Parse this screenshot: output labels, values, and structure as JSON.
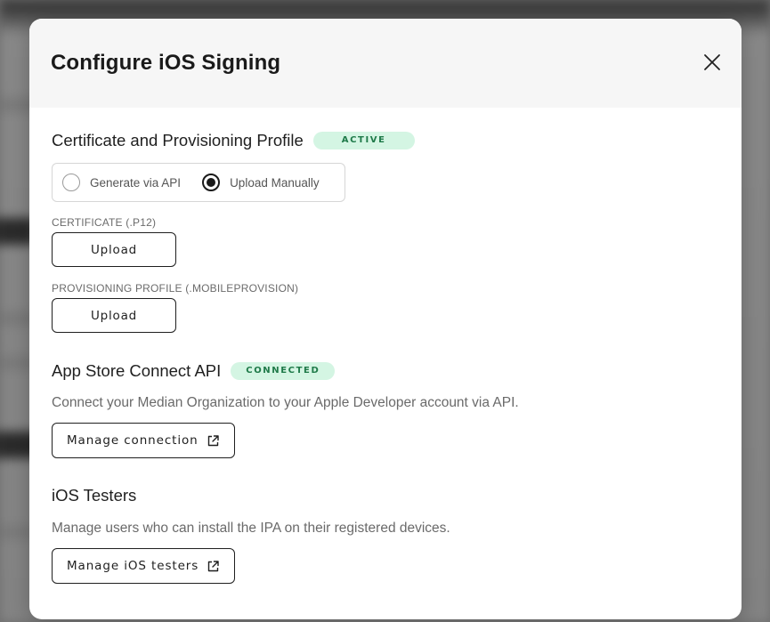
{
  "modal": {
    "title": "Configure iOS Signing",
    "close_icon": "close-icon"
  },
  "signing": {
    "title": "Certificate and Provisioning Profile",
    "badge": "ACTIVE",
    "options": [
      {
        "label": "Generate via API",
        "selected": false
      },
      {
        "label": "Upload Manually",
        "selected": true
      }
    ],
    "certificate_label": "CERTIFICATE (.P12)",
    "certificate_button": "Upload",
    "profile_label": "PROVISIONING PROFILE (.MOBILEPROVISION)",
    "profile_button": "Upload"
  },
  "app_store": {
    "title": "App Store Connect API",
    "badge": "CONNECTED",
    "description": "Connect your Median Organization to your Apple Developer account via API.",
    "button": "Manage connection",
    "button_icon": "external-link-icon"
  },
  "testers": {
    "title": "iOS Testers",
    "description": "Manage users who can install the IPA on their registered devices.",
    "button": "Manage iOS testers",
    "button_icon": "external-link-icon"
  },
  "colors": {
    "badge_bg": "#d4f5e3",
    "badge_text": "#1f7a49",
    "header_bg": "#f6f6f6"
  }
}
